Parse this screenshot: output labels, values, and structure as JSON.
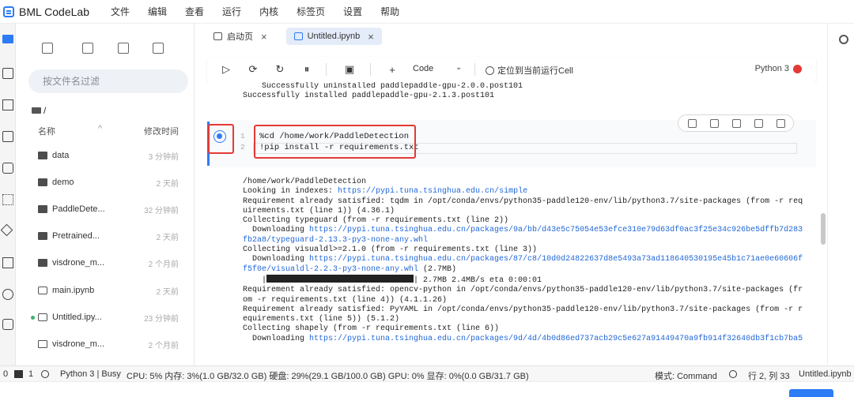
{
  "app": {
    "title": "BML CodeLab"
  },
  "menu": [
    "文件",
    "编辑",
    "查看",
    "运行",
    "内核",
    "标签页",
    "设置",
    "帮助"
  ],
  "filebrowser": {
    "search_placeholder": "按文件名过滤",
    "path": "/",
    "header_name": "名称",
    "header_modified": "修改时间",
    "files": [
      {
        "name": "data",
        "time": "3 分钟前",
        "type": "folder"
      },
      {
        "name": "demo",
        "time": "2 天前",
        "type": "folder"
      },
      {
        "name": "PaddleDete...",
        "time": "32 分钟前",
        "type": "folder"
      },
      {
        "name": "Pretrained...",
        "time": "2 天前",
        "type": "folder"
      },
      {
        "name": "visdrone_m...",
        "time": "2 个月前",
        "type": "folder"
      },
      {
        "name": "main.ipynb",
        "time": "2 天前",
        "type": "notebook"
      },
      {
        "name": "Untitled.ipy...",
        "time": "23 分钟前",
        "type": "notebook"
      },
      {
        "name": "visdrone_m...",
        "time": "2 个月前",
        "type": "text"
      }
    ]
  },
  "tabs": [
    {
      "label": "启动页"
    },
    {
      "label": "Untitled.ipynb"
    }
  ],
  "toolbar": {
    "cell_type": "Code",
    "locate_label": "定位到当前运行Cell",
    "kernel_name": "Python 3"
  },
  "notebook": {
    "prev_output": [
      "    Successfully uninstalled paddlepaddle-gpu-2.0.0.post101",
      "Successfully installed paddlepaddle-gpu-2.1.3.post101"
    ],
    "cell_code": [
      "%cd /home/work/PaddleDetection",
      "!pip install -r requirements.txt"
    ],
    "line_numbers": [
      "1",
      "2"
    ],
    "output": {
      "l1": "/home/work/PaddleDetection",
      "l2a": "Looking in indexes: ",
      "l2link": "https://pypi.tuna.tsinghua.edu.cn/simple",
      "l3": "Requirement already satisfied: tqdm in /opt/conda/envs/python35-paddle120-env/lib/python3.7/site-packages (from -r req",
      "l4": "uirements.txt (line 1)) (4.36.1)",
      "l5": "Collecting typeguard (from -r requirements.txt (line 2))",
      "l6a": "  Downloading ",
      "l6link": "https://pypi.tuna.tsinghua.edu.cn/packages/9a/bb/d43e5c75054e53efce310e79d63df0ac3f25e34c926be5dffb7d283",
      "l7link": "fb2a8/typeguard-2.13.3-py3-none-any.whl",
      "l8": "Collecting visualdl>=2.1.0 (from -r requirements.txt (line 3))",
      "l9a": "  Downloading ",
      "l9link": "https://pypi.tuna.tsinghua.edu.cn/packages/87/c8/10d0d24822637d8e5493a73ad118640530195e45b1c71ae0e60606f",
      "l10link": "f5f0e/visualdl-2.2.3-py3-none-any.whl",
      "l10b": " (2.7MB)",
      "l11a": "    |",
      "l11b": "| 2.7MB 2.4MB/s eta 0:00:01",
      "l12": "Requirement already satisfied: opencv-python in /opt/conda/envs/python35-paddle120-env/lib/python3.7/site-packages (fr",
      "l13": "om -r requirements.txt (line 4)) (4.1.1.26)",
      "l14": "Requirement already satisfied: PyYAML in /opt/conda/envs/python35-paddle120-env/lib/python3.7/site-packages (from -r r",
      "l15": "equirements.txt (line 5)) (5.1.2)",
      "l16": "Collecting shapely (from -r requirements.txt (line 6))",
      "l17a": "  Downloading ",
      "l17link": "https://pypi.tuna.tsinghua.edu.cn/packages/9d/4d/4b0d86ed737acb29c5e627a91449470a9fb914f32640db3f1cb7ba5"
    }
  },
  "statusbar": {
    "left_num0": "0",
    "left_num1": "1",
    "kernel_status": "Python 3 | Busy",
    "resources": "CPU:  5%  内存: 3%(1.0 GB/32.0 GB)  硬盘: 29%(29.1 GB/100.0 GB)  GPU:  0%  显存: 0%(0.0 GB/31.7 GB)",
    "mode": "模式: Command",
    "position": "行 2, 列 33",
    "filename": "Untitled.ipynb"
  },
  "colors": {
    "accent": "#2d7cf6",
    "highlight_red": "#e53935",
    "link": "#2268d8"
  }
}
